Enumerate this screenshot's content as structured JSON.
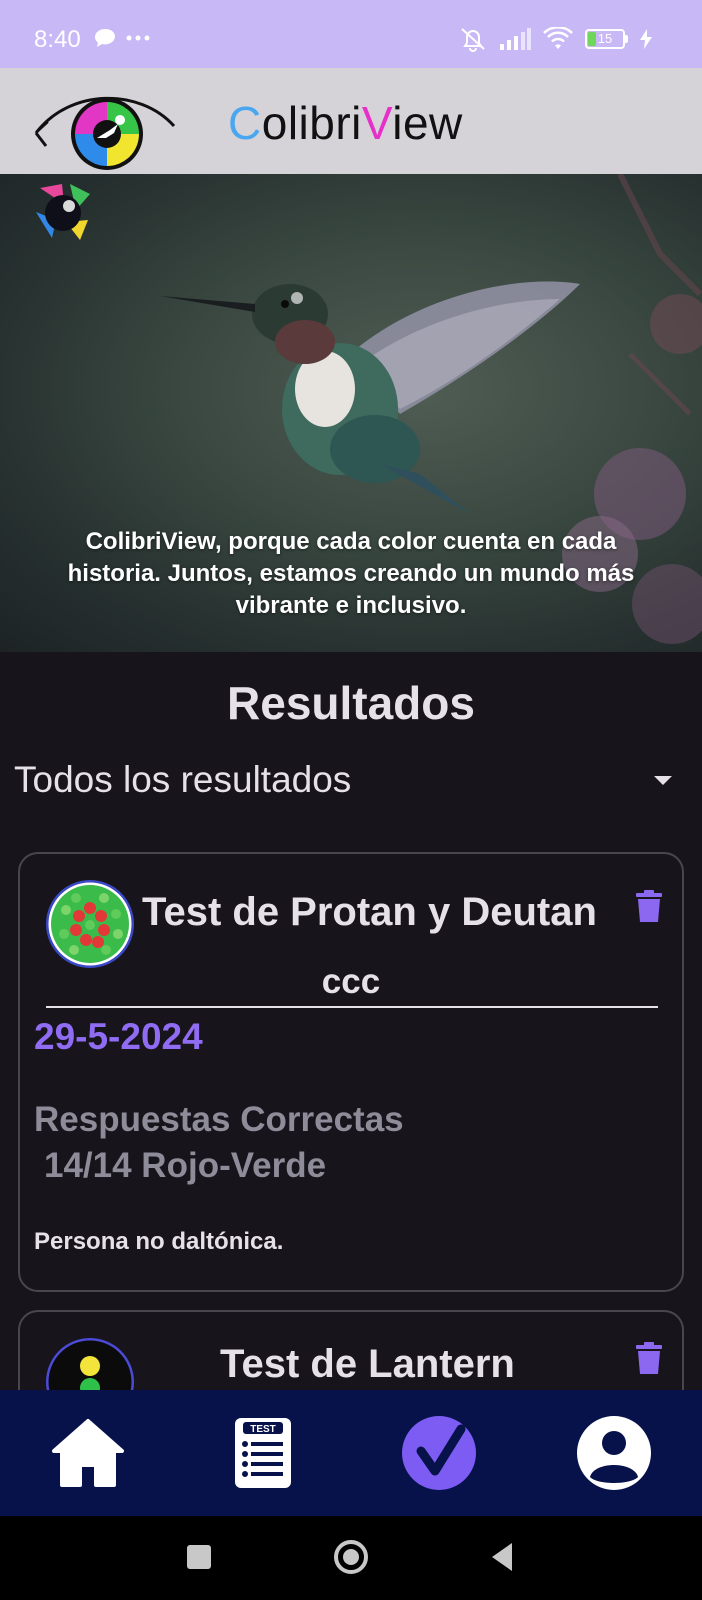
{
  "status_bar": {
    "time": "8:40",
    "battery_level": "15",
    "icons": [
      "chat-bubble-icon",
      "more-dots-icon",
      "mute-icon",
      "signal-icon",
      "wifi-icon",
      "battery-icon",
      "charging-icon"
    ]
  },
  "app": {
    "brand_first": "C",
    "brand_mid": "olibri",
    "brand_v": "V",
    "brand_end": "iew",
    "brand_colors": {
      "c": "#4aa7ef",
      "v": "#e630c9",
      "rest": "#111111"
    }
  },
  "hero": {
    "tagline": "ColibriView, porque cada color cuenta en cada historia. Juntos, estamos creando un mundo más vibrante e inclusivo."
  },
  "results": {
    "title": "Resultados",
    "filter": {
      "selected": "Todos los resultados"
    },
    "cards": [
      {
        "test_name": "Test de Protan y Deutan",
        "user": "ccc",
        "date": "29-5-2024",
        "score_label": "Respuestas Correctas",
        "score_value": "14/14 Rojo-Verde",
        "diagnosis": "Persona no daltónica.",
        "icon": "ishihara-plate-icon"
      },
      {
        "test_name": "Test de Lantern",
        "icon": "traffic-light-icon"
      }
    ]
  },
  "bottom_nav": {
    "items": [
      "home-icon",
      "test-list-icon",
      "results-check-icon",
      "profile-icon"
    ],
    "active": "results-check-icon",
    "accent": "#7c5cf2",
    "background": "#07114a"
  },
  "colors": {
    "status_bar": "#c9b8f6",
    "header": "#d6d3d8",
    "background": "#17141c",
    "accent_date": "#8f6cf2"
  }
}
